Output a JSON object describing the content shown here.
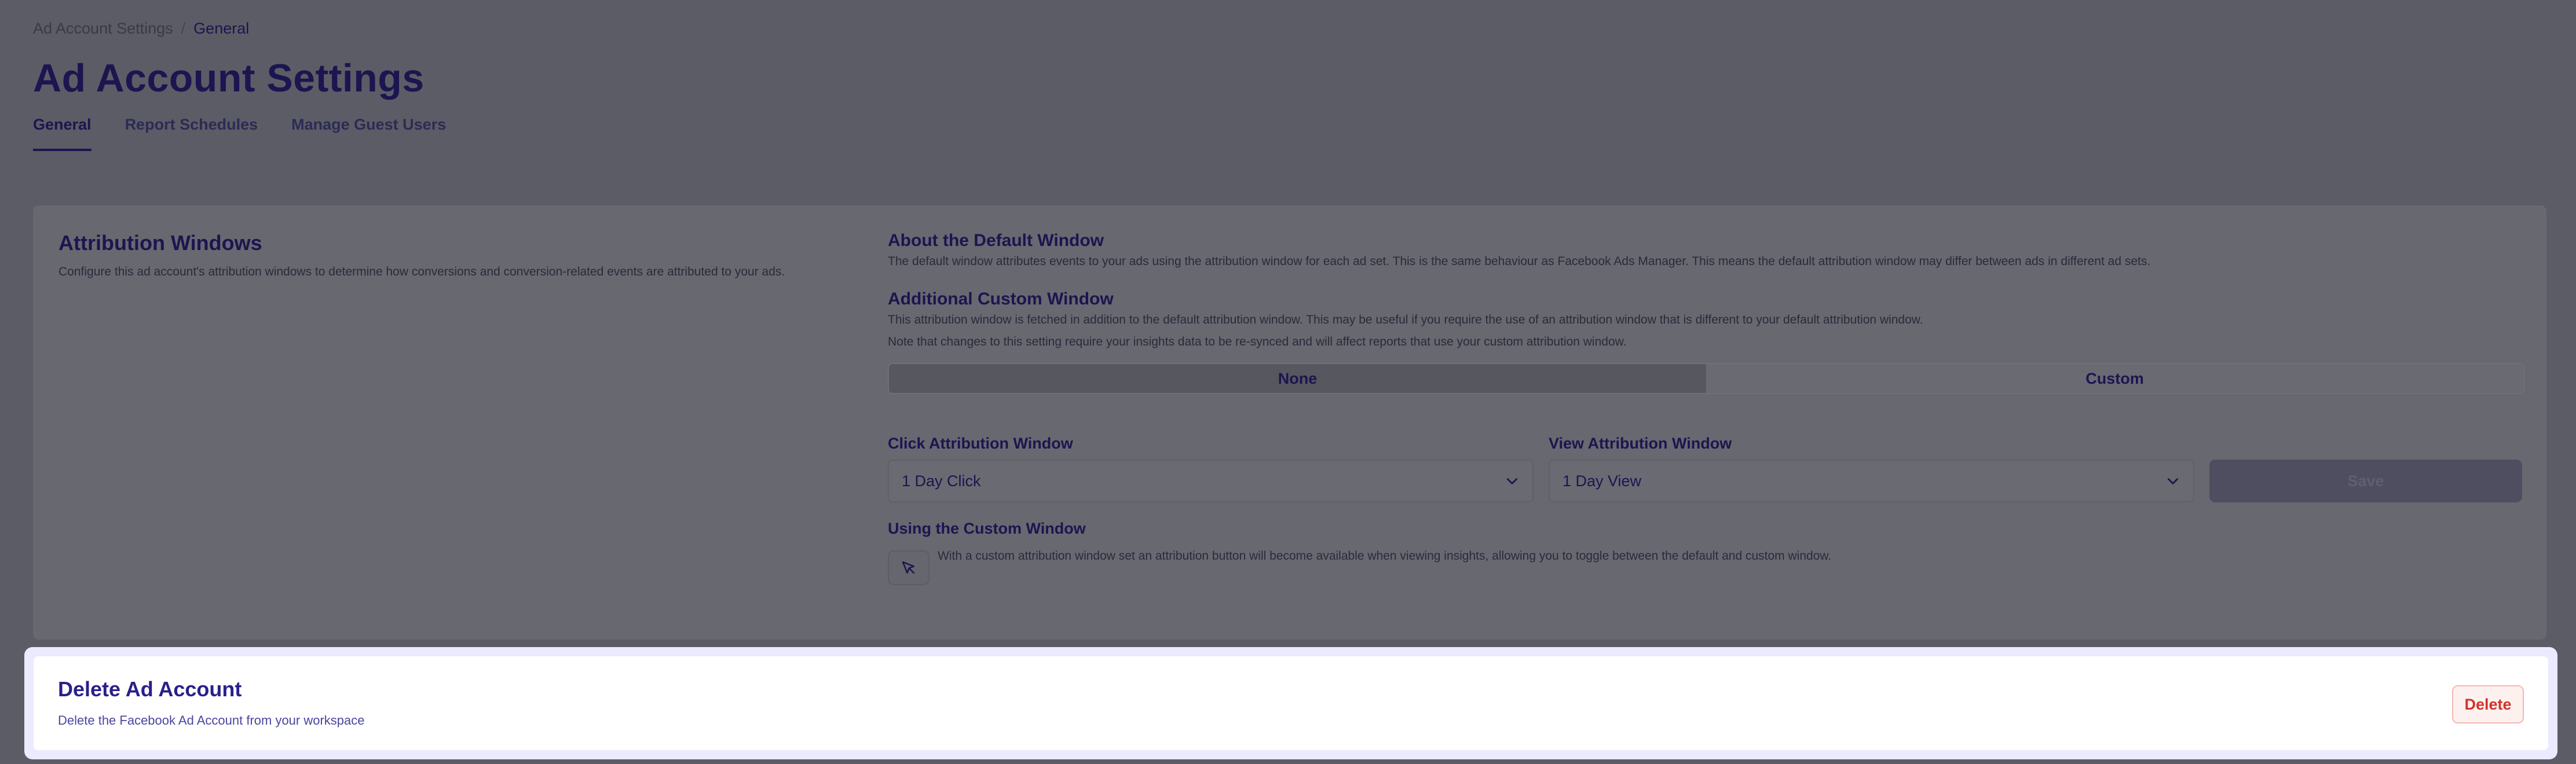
{
  "breadcrumb": {
    "parent": "Ad Account Settings",
    "separator": "/",
    "current": "General"
  },
  "page": {
    "title": "Ad Account Settings"
  },
  "tabs": [
    {
      "label": "General",
      "active": true
    },
    {
      "label": "Report Schedules",
      "active": false
    },
    {
      "label": "Manage Guest Users",
      "active": false
    }
  ],
  "attribution": {
    "title": "Attribution Windows",
    "description": "Configure this ad account's attribution windows to determine how conversions and conversion-related events are attributed to your ads.",
    "default_window": {
      "title": "About the Default Window",
      "description": "The default window attributes events to your ads using the attribution window for each ad set. This is the same behaviour as Facebook Ads Manager. This means the default attribution window may differ between ads in different ad sets."
    },
    "custom_window": {
      "title": "Additional Custom Window",
      "description": "This attribution window is fetched in addition to the default attribution window. This may be useful if you require the use of an attribution window that is different to your default attribution window.",
      "note": "Note that changes to this setting require your insights data to be re-synced and will affect reports that use your custom attribution window."
    },
    "segment": {
      "options": [
        "None",
        "Custom"
      ],
      "selected": "None"
    },
    "click_field": {
      "label": "Click Attribution Window",
      "value": "1 Day Click"
    },
    "view_field": {
      "label": "View Attribution Window",
      "value": "1 Day View"
    },
    "save_label": "Save",
    "using": {
      "title": "Using the Custom Window",
      "description": "With a custom attribution window set an attribution button will become available when viewing insights, allowing you to toggle between the default and custom window."
    }
  },
  "delete_section": {
    "title": "Delete Ad Account",
    "description": "Delete the Facebook Ad Account from your workspace",
    "button_label": "Delete"
  },
  "icons": {
    "select": "chevron-down-icon",
    "using": "cursor-pointer-icon"
  },
  "colors": {
    "accent": "#1b1550",
    "danger": "#d0342a",
    "overlay": "#5c5c66"
  }
}
